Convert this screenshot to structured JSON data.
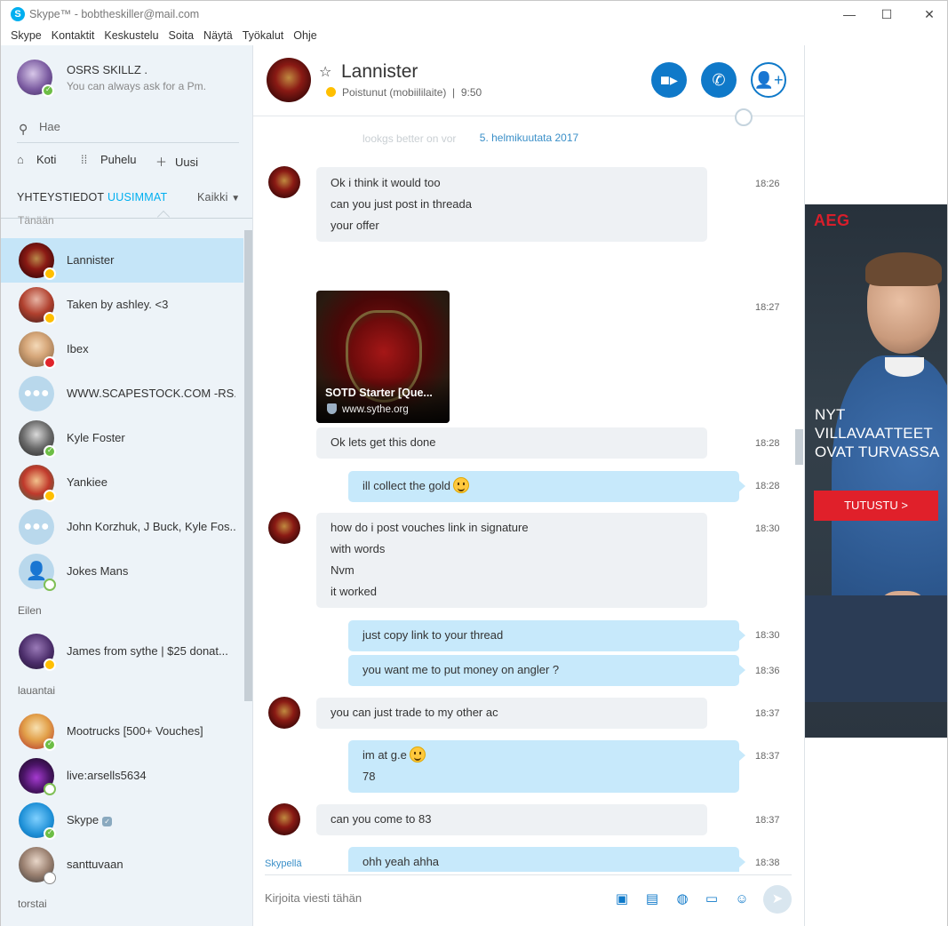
{
  "window": {
    "title": "Skype™ - bobtheskiller@mail.com",
    "menu": [
      "Skype",
      "Kontaktit",
      "Keskustelu",
      "Soita",
      "Näytä",
      "Työkalut",
      "Ohje"
    ]
  },
  "profile": {
    "name": "OSRS SKILLZ .",
    "mood": "You can always ask for a Pm."
  },
  "search": {
    "placeholder": "Hae"
  },
  "nav": {
    "home": "Koti",
    "call": "Puhelu",
    "new": "Uusi"
  },
  "tabs": {
    "contacts": "YHTEYSTIEDOT",
    "recent": "UUSIMMAT",
    "filter": "Kaikki"
  },
  "groups": {
    "today": "Tänään",
    "yesterday": "Eilen",
    "saturday": "lauantai",
    "thursday": "torstai"
  },
  "contacts": [
    {
      "name": "Lannister",
      "status": "away",
      "selected": true
    },
    {
      "name": "Taken by ashley. <3",
      "status": "away"
    },
    {
      "name": "Ibex",
      "status": "dnd"
    },
    {
      "name": "WWW.SCAPESTOCK.COM -RS...",
      "status": "none",
      "group": true
    },
    {
      "name": "Kyle Foster",
      "status": "online"
    },
    {
      "name": "Yankiee",
      "status": "away"
    },
    {
      "name": "John Korzhuk, J Buck, Kyle Fos...",
      "status": "none",
      "group": true
    },
    {
      "name": "Jokes Mans",
      "status": "offline",
      "placeholder": true
    },
    {
      "name": "James from sythe | $25 donat...",
      "status": "away"
    },
    {
      "name": "Mootrucks [500+ Vouches]",
      "status": "online"
    },
    {
      "name": "live:arsells5634",
      "status": "offline"
    },
    {
      "name": "Skype",
      "status": "online",
      "verified": true
    },
    {
      "name": "santtuvaan",
      "status": "unknown"
    }
  ],
  "chat": {
    "name": "Lannister",
    "status_text": "Poistunut (mobiililaite)",
    "local_time": "9:50",
    "date_separator": "5. helmikuutata 2017",
    "ghost_text": "lookgs better on vor",
    "link_card": {
      "title": "SOTD Starter [Que...",
      "site": "www.sythe.org"
    },
    "messages": [
      {
        "dir": "in",
        "avatar": true,
        "lines": [
          "Ok i think it would too",
          "can you just post in threada",
          "your offer"
        ],
        "time": "18:26"
      },
      {
        "dir": "in",
        "card": true,
        "time": "18:27"
      },
      {
        "dir": "in",
        "lines": [
          "Ok lets get this done"
        ],
        "time": "18:28"
      },
      {
        "dir": "out",
        "lines": [
          "ill collect the gold"
        ],
        "emoji": "tongue-emoji",
        "time": "18:28"
      },
      {
        "dir": "in",
        "avatar": true,
        "lines": [
          "how do i post vouches link in signature",
          "with words",
          "Nvm",
          "it worked"
        ],
        "time": "18:30"
      },
      {
        "dir": "out",
        "lines": [
          "just copy link to your thread"
        ],
        "time": "18:30"
      },
      {
        "dir": "out",
        "lines": [
          "you want me to put money on angler ?"
        ],
        "time": "18:36"
      },
      {
        "dir": "in",
        "avatar": true,
        "lines": [
          "you can just trade to my other ac"
        ],
        "time": "18:37"
      },
      {
        "dir": "out",
        "lines": [
          "im at g.e",
          "78"
        ],
        "emoji": "smile-emoji",
        "time": "18:37"
      },
      {
        "dir": "in",
        "avatar": true,
        "lines": [
          "can you come to 83"
        ],
        "time": "18:37"
      },
      {
        "dir": "out",
        "lines": [
          "ohh yeah ahha"
        ],
        "time": "18:38"
      }
    ]
  },
  "composer": {
    "via": "Skypellä",
    "placeholder": "Kirjoita viesti tähän"
  },
  "ad": {
    "brand": "AEG",
    "headline": [
      "NYT",
      "VILLAVAATTEET",
      "OVAT TURVASSA"
    ],
    "cta": "TUTUSTU >"
  },
  "colors": {
    "accent": "#00aff0",
    "button_blue": "#0f79c9",
    "outgoing_bubble": "#c7e9fb",
    "incoming_bubble": "#eef1f4",
    "selected_row": "#c5e5f8"
  }
}
